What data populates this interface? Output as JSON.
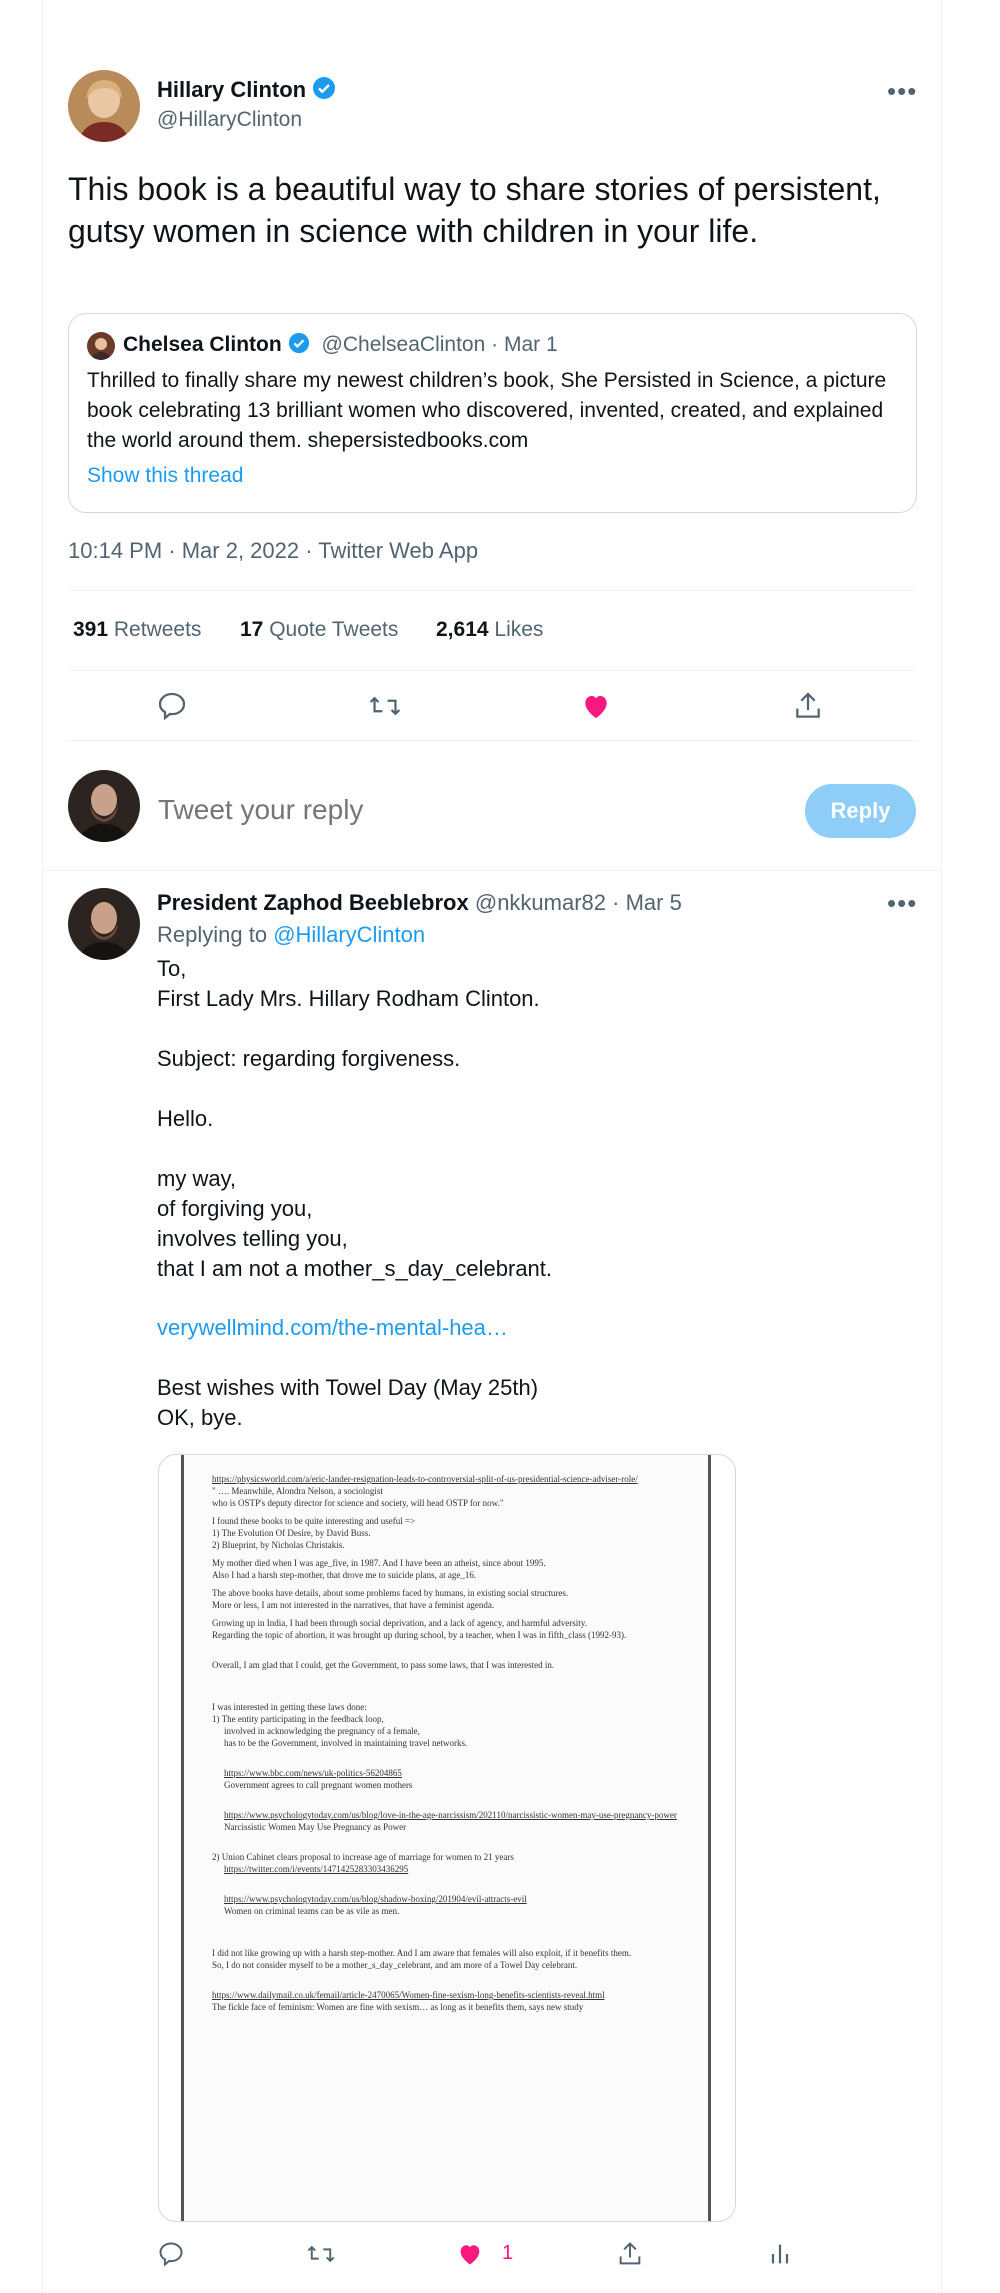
{
  "main_tweet": {
    "author_name": "Hillary Clinton",
    "author_handle": "@HillaryClinton",
    "text": "This book is a beautiful way to share stories of persistent, gutsy women in science with children in your life.",
    "quoted": {
      "author_name": "Chelsea Clinton",
      "author_handle": "@ChelseaClinton",
      "date": "· Mar 1",
      "text": "Thrilled to finally share my newest children’s book, She Persisted in Science, a picture book celebrating 13 brilliant women who discovered, invented, created, and explained the world around them. shepersistedbooks.com",
      "show_thread": "Show this thread"
    },
    "timestamp": "10:14 PM · Mar 2, 2022 · Twitter Web App",
    "stats": {
      "retweets_count": "391",
      "retweets_label": "Retweets",
      "quotes_count": "17",
      "quotes_label": "Quote Tweets",
      "likes_count": "2,614",
      "likes_label": "Likes"
    }
  },
  "composer": {
    "placeholder": "Tweet your reply",
    "reply_button": "Reply"
  },
  "reply_tweet": {
    "author_name": "President Zaphod Beeblebrox",
    "author_handle": "@nkkumar82",
    "date": "· Mar 5",
    "replying_to_label": "Replying to",
    "replying_to_handle": "@HillaryClinton",
    "body_part1": "To,\nFirst Lady Mrs. Hillary Rodham Clinton.\n\nSubject:  regarding forgiveness.\n\nHello.\n\nmy way,\nof forgiving you,\ninvolves telling  you,\nthat I am not a mother_s_day_celebrant.",
    "link": "verywellmind.com/the-mental-hea…",
    "body_part2": "Best wishes with Towel Day (May 25th)\nOK, bye.",
    "like_count": "1",
    "document": {
      "l1": "https://physicsworld.com/a/eric-lander-resignation-leads-to-controversial-split-of-us-presidential-science-adviser-role/",
      "l2": "\" ….  Meanwhile, Alondra Nelson,    a sociologist",
      "l3": "who is OSTP's deputy director for science and society, will head OSTP for now.\"",
      "l4": "I found these books to be quite interesting and useful =>",
      "l5": "1)  The Evolution Of Desire, by David Buss.",
      "l6": "2)  Blueprint, by Nicholas Christakis.",
      "l7": "My mother died when I was age_five, in 1987. And I have been an atheist, since about 1995.",
      "l8": "Also I had a harsh step-mother, that drove me to suicide plans, at age_16.",
      "l9": "The above books have details, about some problems faced by humans, in existing social structures.",
      "l10": "More or less, I am not interested in the narratives, that have a feminist agenda.",
      "l11": "Growing up in India, I had been through social deprivation, and a lack of agency, and harmful adversity.",
      "l12": "Regarding the topic of abortion, it was brought up during school, by a teacher, when I was in fifth_class (1992-93).",
      "l13": "Overall, I am glad that I could, get the Government, to pass some laws, that I was interested in.",
      "l14": "I was interested in getting these laws done:",
      "l15": "1)  The entity participating in the feedback loop,",
      "l16": "involved in acknowledging the pregnancy of a female,",
      "l17": "has to be the Government, involved in maintaining travel networks.",
      "l18": "https://www.bbc.com/news/uk-politics-56204865",
      "l19": "Government agrees to call pregnant women mothers",
      "l20": "https://www.psychologytoday.com/us/blog/love-in-the-age-narcissism/202110/narcissistic-women-may-use-pregnancy-power",
      "l21": "Narcissistic Women May Use Pregnancy as Power",
      "l22": "2)  Union Cabinet clears proposal to increase age of marriage for women to 21 years",
      "l23": "https://twitter.com/i/events/1471425283303436295",
      "l24": "https://www.psychologytoday.com/us/blog/shadow-boxing/201904/evil-attracts-evil",
      "l25": "Women on criminal teams can be as vile as men.",
      "l26": "I did not like growing up with a harsh step-mother. And I am aware that females will also exploit, if it benefits them.",
      "l27": "So, I do not consider myself to be a mother_s_day_celebrant, and am more of a Towel Day celebrant.",
      "l28": "https://www.dailymail.co.uk/femail/article-2470065/Women-fine-sexism-long-benefits-scientists-reveal.html",
      "l29": "The fickle face of feminism: Women are fine with sexism… as long as it benefits them, says new study"
    }
  },
  "colors": {
    "accent": "#1d9bf0",
    "like": "#f91880",
    "muted": "#536471",
    "reply_disabled": "#8ecdf8",
    "border": "#eff3f4"
  },
  "icons": [
    "verified-badge-icon",
    "more-icon",
    "reply-icon",
    "retweet-icon",
    "like-icon",
    "share-icon",
    "analytics-icon"
  ]
}
